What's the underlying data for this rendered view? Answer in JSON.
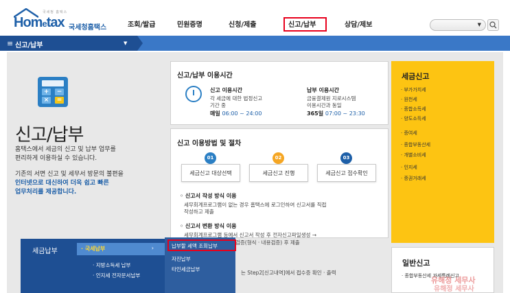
{
  "header": {
    "logo_small": "국세청 홈택스",
    "logo_hom": "Hom",
    "logo_e": "e",
    "logo_tax": "tax",
    "logo_sub": "국세청홈택스",
    "nav": [
      "조회/발급",
      "민원증명",
      "신청/제출",
      "신고/납부",
      "상담/제보"
    ],
    "active_nav": "신고/납부"
  },
  "bluebar": {
    "label": "신고/납부"
  },
  "left": {
    "title": "신고/납부",
    "intro_line1": "홈택스에서 세금의 신고 및 납부 업무를",
    "intro_line2": "편리하게 이용하실 수 있습니다.",
    "intro_line3": "기존의 서면 신고 및 세무서 방문의 불편을",
    "intro_em1": "인터넷으로 대신하여 더욱 쉽고 빠른",
    "intro_em2": "업무처리를 제공합니다."
  },
  "hours": {
    "title": "신고/납부 이용시간",
    "report_title": "신고 이용시간",
    "report_desc1": "각 세금에 대한 법정신고",
    "report_desc2": "기간 중",
    "report_time_label": "매일",
    "report_time": "06:00 ~ 24:00",
    "pay_title": "납부 이용시간",
    "pay_desc1": "금융결제원 지로시스템",
    "pay_desc2": "이용시간과 동일",
    "pay_time_label": "365일",
    "pay_time": "07:00 ~ 23:30"
  },
  "procedure": {
    "title": "신고 이용방법 및 절차",
    "steps": [
      {
        "num": "01",
        "label": "세금신고 대상선택",
        "color": "#2b7fc4"
      },
      {
        "num": "02",
        "label": "세금신고 진행",
        "color": "#f5a623"
      },
      {
        "num": "03",
        "label": "세금신고 접수확인",
        "color": "#1d5fa8"
      }
    ],
    "method1_title": "◦ 신고서 작성 방식 이용",
    "method1_desc1": "세무회계프로그램이 없는 경우 홈택스에 로그인하여 신고서를 직접",
    "method1_desc2": "작성하고 제출",
    "method2_title": "◦ 신고서 변환 방식 이용",
    "method2_desc1": "세무회계프로그램 등에서 신고서 작성 후 전자신고파일생성 →",
    "method2_desc2": "검증(형식 · 내용검증) 후 제출",
    "method3_desc": "는 Step2[신고내역]에서 접수증 확인 · 출력"
  },
  "tax_report": {
    "title": "세금신고",
    "items": [
      "· 부가가치세",
      "· 원천세",
      "· 종합소득세",
      "· 양도소득세",
      "· 증여세",
      "· 종합부동산세",
      "· 개별소비세",
      "· 인지세",
      "· 증권거래세"
    ]
  },
  "general_report": {
    "title": "일반신고",
    "item": "· 종합부동산세 과세특례신고"
  },
  "dropdown": {
    "left_label": "세금납부",
    "highlight_label": "· 국세납부",
    "highlight_arrow": "›",
    "sub_items": [
      "· 지방소득세 납부",
      "· 인지세 전자문서납부"
    ],
    "right_items": [
      "납부할 세액 조회납부",
      "자진납부",
      "타인세금납부"
    ]
  },
  "watermark": {
    "line1": "유해정 세무사",
    "line2": "유해정 세무사"
  }
}
